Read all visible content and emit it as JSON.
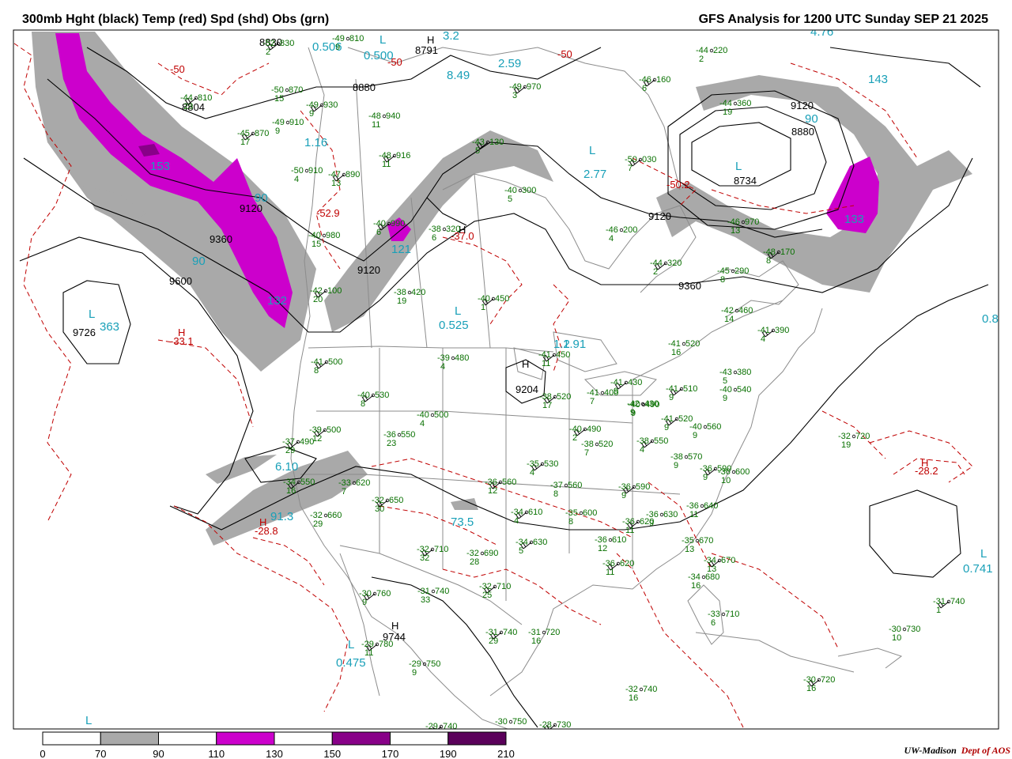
{
  "header": {
    "title_left": "300mb Hght (black) Temp (red) Spd (shd) Obs (grn)",
    "title_right": "GFS Analysis for 1200 UTC Sunday  SEP 21 2025"
  },
  "credit": {
    "org": "UW-Madison",
    "dept": "Dept of AOS"
  },
  "colors": {
    "height": "#000000",
    "temperature": "#c00000",
    "speed_label": "#19a0b8",
    "observation": "#087000",
    "geography": "#8c8c8c",
    "speed_70_90": "#a9a9a9",
    "speed_110_130": "#cc00cc",
    "speed_150_170": "#880088",
    "speed_190_210": "#5a005a"
  },
  "legend": {
    "ticks": [
      "0",
      "70",
      "90",
      "110",
      "130",
      "150",
      "170",
      "190",
      "210"
    ],
    "segment_colors": [
      "#ffffff",
      "#a9a9a9",
      "#ffffff",
      "#cc00cc",
      "#ffffff",
      "#880088",
      "#ffffff",
      "#5a005a"
    ]
  },
  "height_labels": [
    "8830",
    "8791",
    "8880",
    "8804",
    "9120",
    "9360",
    "9600",
    "9726",
    "9120",
    "9120",
    "9204",
    "9360",
    "8734",
    "8880",
    "9120",
    "9744"
  ],
  "temp_labels": [
    "-50",
    "-50",
    "-50",
    "-52.9",
    "-37.0",
    "-33.1",
    "-50.2",
    "-28.8",
    "-28.2"
  ],
  "pressure_centers": {
    "H": [
      "H",
      "H",
      "H",
      "H",
      "H",
      "H",
      "H"
    ],
    "L": [
      "L",
      "L",
      "L",
      "L",
      "L",
      "L",
      "L",
      "L"
    ]
  },
  "speed_labels": [
    "0.506",
    "0.500",
    "3.2",
    "8.49",
    "2.59",
    "1.16",
    "153",
    "90",
    "90",
    "121",
    "1.2",
    "0.525",
    "1.91",
    "2.77",
    "90",
    "133",
    "6.10",
    "91.3",
    "73.5",
    "0.475",
    "0.741",
    "0.8",
    "4.76",
    "143",
    "132",
    "363"
  ],
  "observations": [
    {
      "t": "-52",
      "h": "830",
      "d": "2"
    },
    {
      "t": "-49",
      "h": "810",
      "d": "9"
    },
    {
      "t": "-44",
      "h": "810",
      "d": "23"
    },
    {
      "t": "-50",
      "h": "870",
      "d": "15"
    },
    {
      "t": "-49",
      "h": "930",
      "d": "9"
    },
    {
      "t": "-49",
      "h": "910",
      "d": "9"
    },
    {
      "t": "-45",
      "h": "870",
      "d": "17"
    },
    {
      "t": "-48",
      "h": "940",
      "d": "11"
    },
    {
      "t": "-48",
      "h": "916",
      "d": "11"
    },
    {
      "t": "-50",
      "h": "910",
      "d": "4"
    },
    {
      "t": "-47",
      "h": "890",
      "d": "13"
    },
    {
      "t": "-40",
      "h": "980",
      "d": "15"
    },
    {
      "t": "-40",
      "h": "990",
      "d": "6"
    },
    {
      "t": "-38",
      "h": "320",
      "d": "6"
    },
    {
      "t": "-43",
      "h": "130",
      "d": "5"
    },
    {
      "t": "-40",
      "h": "300",
      "d": "5"
    },
    {
      "t": "-49",
      "h": "970",
      "d": "3"
    },
    {
      "t": "-44",
      "h": "220",
      "d": "2"
    },
    {
      "t": "-46",
      "h": "160",
      "d": "6"
    },
    {
      "t": "-44",
      "h": "360",
      "d": "19"
    },
    {
      "t": "-50",
      "h": "030",
      "d": "7"
    },
    {
      "t": "-46",
      "h": "200",
      "d": "4"
    },
    {
      "t": "-44",
      "h": "320",
      "d": "2"
    },
    {
      "t": "-46",
      "h": "970",
      "d": "13"
    },
    {
      "t": "-48",
      "h": "170",
      "d": "8"
    },
    {
      "t": "-45",
      "h": "290",
      "d": "8"
    },
    {
      "t": "-42",
      "h": "100",
      "d": "20"
    },
    {
      "t": "-38",
      "h": "420",
      "d": "19"
    },
    {
      "t": "-40",
      "h": "450",
      "d": "1"
    },
    {
      "t": "-42",
      "h": "460",
      "d": "14"
    },
    {
      "t": "-41",
      "h": "390",
      "d": "4"
    },
    {
      "t": "-41",
      "h": "520",
      "d": "16"
    },
    {
      "t": "-41",
      "h": "500",
      "d": "8"
    },
    {
      "t": "-39",
      "h": "480",
      "d": "4"
    },
    {
      "t": "-41",
      "h": "450",
      "d": "11"
    },
    {
      "t": "-43",
      "h": "380",
      "d": "5"
    },
    {
      "t": "-40",
      "h": "530",
      "d": "8"
    },
    {
      "t": "-40",
      "h": "500",
      "d": "4"
    },
    {
      "t": "-38",
      "h": "520",
      "d": "17"
    },
    {
      "t": "-41",
      "h": "400",
      "d": "7"
    },
    {
      "t": "-41",
      "h": "430",
      "d": "9"
    },
    {
      "t": "-42",
      "h": "430",
      "d": "9"
    },
    {
      "t": "-41",
      "h": "510",
      "d": "9"
    },
    {
      "t": "-40",
      "h": "540",
      "d": "9"
    },
    {
      "t": "-39",
      "h": "500",
      "d": "12"
    },
    {
      "t": "-36",
      "h": "550",
      "d": "23"
    },
    {
      "t": "-40",
      "h": "490",
      "d": "2"
    },
    {
      "t": "-40",
      "h": "490",
      "d": "9"
    },
    {
      "t": "-41",
      "h": "520",
      "d": "9"
    },
    {
      "t": "-40",
      "h": "560",
      "d": "9"
    },
    {
      "t": "-37",
      "h": "490",
      "d": "29"
    },
    {
      "t": "-38",
      "h": "520",
      "d": "7"
    },
    {
      "t": "-38",
      "h": "550",
      "d": "4"
    },
    {
      "t": "-32",
      "h": "720",
      "d": "19"
    },
    {
      "t": "-34",
      "h": "550",
      "d": "16"
    },
    {
      "t": "-33",
      "h": "620",
      "d": "7"
    },
    {
      "t": "-35",
      "h": "530",
      "d": "4"
    },
    {
      "t": "-38",
      "h": "570",
      "d": "9"
    },
    {
      "t": "-36",
      "h": "590",
      "d": "9"
    },
    {
      "t": "-36",
      "h": "600",
      "d": "10"
    },
    {
      "t": "-32",
      "h": "650",
      "d": "30"
    },
    {
      "t": "-32",
      "h": "660",
      "d": "29"
    },
    {
      "t": "-36",
      "h": "560",
      "d": "12"
    },
    {
      "t": "-37",
      "h": "560",
      "d": "8"
    },
    {
      "t": "-36",
      "h": "590",
      "d": "9"
    },
    {
      "t": "-36",
      "h": "640",
      "d": "11"
    },
    {
      "t": "-34",
      "h": "610",
      "d": "4"
    },
    {
      "t": "-35",
      "h": "600",
      "d": "8"
    },
    {
      "t": "-36",
      "h": "620",
      "d": "11"
    },
    {
      "t": "-36",
      "h": "630",
      "d": "9"
    },
    {
      "t": "-34",
      "h": "630",
      "d": "5"
    },
    {
      "t": "-36",
      "h": "610",
      "d": "12"
    },
    {
      "t": "-32",
      "h": "710",
      "d": "32"
    },
    {
      "t": "-32",
      "h": "690",
      "d": "28"
    },
    {
      "t": "-36",
      "h": "620",
      "d": "11"
    },
    {
      "t": "-35",
      "h": "670",
      "d": "13"
    },
    {
      "t": "-34",
      "h": "670",
      "d": "13"
    },
    {
      "t": "-34",
      "h": "680",
      "d": "16"
    },
    {
      "t": "-30",
      "h": "760",
      "d": "9"
    },
    {
      "t": "-31",
      "h": "740",
      "d": "33"
    },
    {
      "t": "-32",
      "h": "710",
      "d": "25"
    },
    {
      "t": "-33",
      "h": "710",
      "d": "6"
    },
    {
      "t": "-31",
      "h": "740",
      "d": "29"
    },
    {
      "t": "-31",
      "h": "720",
      "d": "16"
    },
    {
      "t": "-29",
      "h": "780",
      "d": "11"
    },
    {
      "t": "-29",
      "h": "750",
      "d": "9"
    },
    {
      "t": "-31",
      "h": "740",
      "d": "1"
    },
    {
      "t": "-30",
      "h": "730",
      "d": "10"
    },
    {
      "t": "-30",
      "h": "720",
      "d": "16"
    },
    {
      "t": "-32",
      "h": "740",
      "d": "16"
    },
    {
      "t": "-29",
      "h": "740",
      "d": ""
    },
    {
      "t": "-30",
      "h": "750",
      "d": ""
    },
    {
      "t": "-28",
      "h": "730",
      "d": ""
    }
  ]
}
